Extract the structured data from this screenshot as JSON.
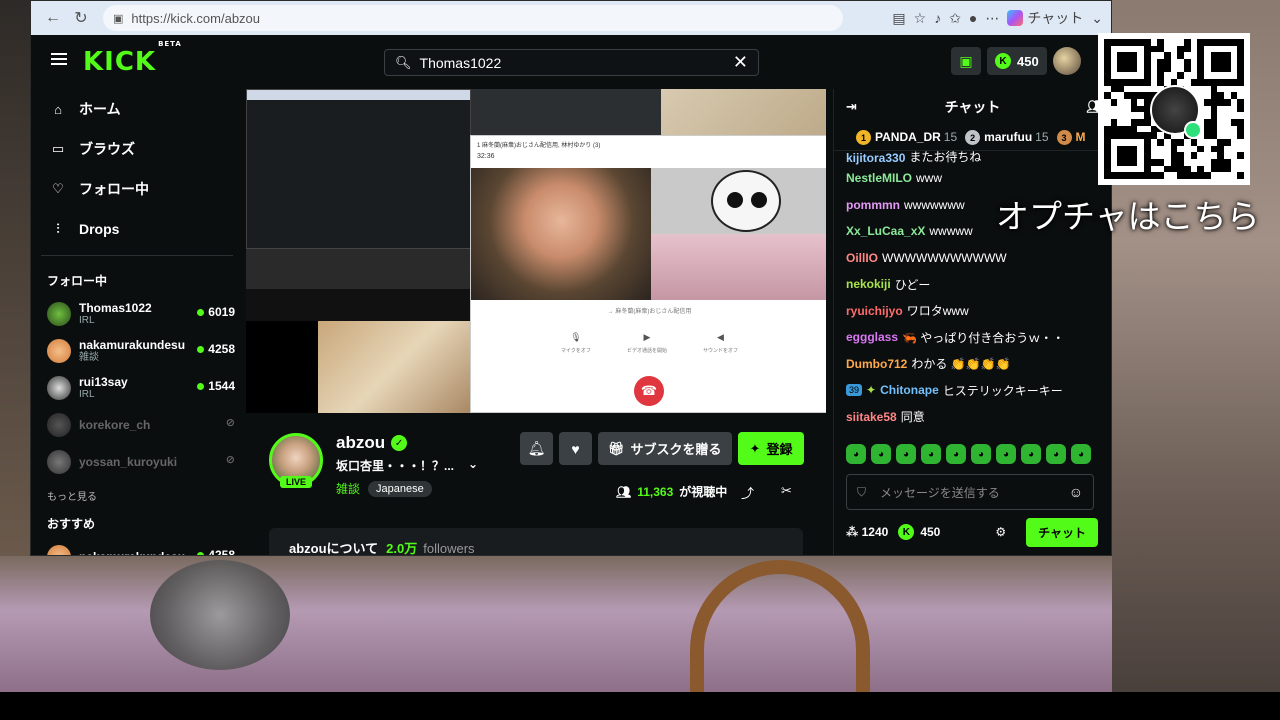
{
  "browser": {
    "url": "https://kick.com/abzou",
    "copilot_label": "チャット"
  },
  "header": {
    "logo": "KICK",
    "logo_badge": "BETA",
    "search_value": "Thomas1022",
    "coins": "450"
  },
  "sidebar": {
    "nav": [
      {
        "label": "ホーム",
        "icon": "home-icon"
      },
      {
        "label": "ブラウズ",
        "icon": "browse-icon"
      },
      {
        "label": "フォロー中",
        "icon": "heart-icon"
      },
      {
        "label": "Drops",
        "icon": "drops-icon"
      }
    ],
    "following_title": "フォロー中",
    "following": [
      {
        "name": "Thomas1022",
        "category": "IRL",
        "viewers": "6019"
      },
      {
        "name": "nakamurakundesu",
        "category": "雑談",
        "viewers": "4258"
      },
      {
        "name": "rui13say",
        "category": "IRL",
        "viewers": "1544"
      },
      {
        "name": "korekore_ch"
      },
      {
        "name": "yossan_kuroyuki"
      }
    ],
    "show_more": "もっと見る",
    "recommended_title": "おすすめ",
    "recommended": [
      {
        "name": "nakamurakundesu",
        "viewers": "4258"
      }
    ]
  },
  "video": {
    "call_title": "1 麻冬蘭(麻衆)おじさん配信用, 林村ゆかり (3)",
    "call_time": "32:36",
    "call_caption": "→ 麻冬蘭(麻衆)おじさん配信用",
    "controls": [
      "マイクをオフ",
      "ビデオ通話を開始",
      "サウンドをオフ"
    ]
  },
  "stream": {
    "streamer": "abzou",
    "title": "坂口杏里・・・！？...",
    "live_label": "LIVE",
    "category": "雑談",
    "tag": "Japanese",
    "gift_label": "サブスクを贈る",
    "subscribe_label": "登録",
    "viewers": "11,363",
    "viewers_suffix": "が視聴中",
    "about": "abzouについて",
    "followers_count": "2.0万",
    "followers_label": "followers"
  },
  "chat": {
    "title": "チャット",
    "leaderboard": [
      {
        "rank": "1",
        "name": "PANDA_DR",
        "score": "15",
        "color": "#f0b429"
      },
      {
        "rank": "2",
        "name": "marufuu",
        "score": "15",
        "color": "#c0c4c8"
      },
      {
        "rank": "3",
        "name": "M",
        "score": "",
        "color": "#d08a4a"
      }
    ],
    "messages": [
      {
        "user": "kijitora330",
        "text": "またお待ちね",
        "color": "#9cf"
      },
      {
        "user": "NestleMILO",
        "text": "www",
        "color": "#8ce99a"
      },
      {
        "user": "pommmn",
        "text": "wwwwwww",
        "color": "#e599f7"
      },
      {
        "user": "Xx_LuCaa_xX",
        "text": "wwwww",
        "color": "#8ce99a"
      },
      {
        "user": "OillIO",
        "text": "WWWWWWWWWWW",
        "color": "#ff8787"
      },
      {
        "user": "nekokiji",
        "text": "ひどー",
        "color": "#a9e34b"
      },
      {
        "user": "ryuichijyo",
        "text": "ワロタwww",
        "color": "#ff6b6b"
      },
      {
        "user": "eggglass",
        "text": "🦐 やっぱり付き合おうｗ・・",
        "color": "#da77f2"
      },
      {
        "user": "Dumbo712",
        "text": "わかる 👏👏👏👏",
        "color": "#ffa94d"
      },
      {
        "user": "Chitonape",
        "text": "ヒステリックキーキー",
        "color": "#74c0fc"
      },
      {
        "user": "siitake58",
        "text": "同意",
        "color": "#ff8787"
      }
    ],
    "input_placeholder": "メッセージを送信する",
    "points": "1240",
    "coins": "450",
    "send_label": "チャット"
  },
  "overlay": {
    "qr_caption": "オプチャはこちら"
  }
}
